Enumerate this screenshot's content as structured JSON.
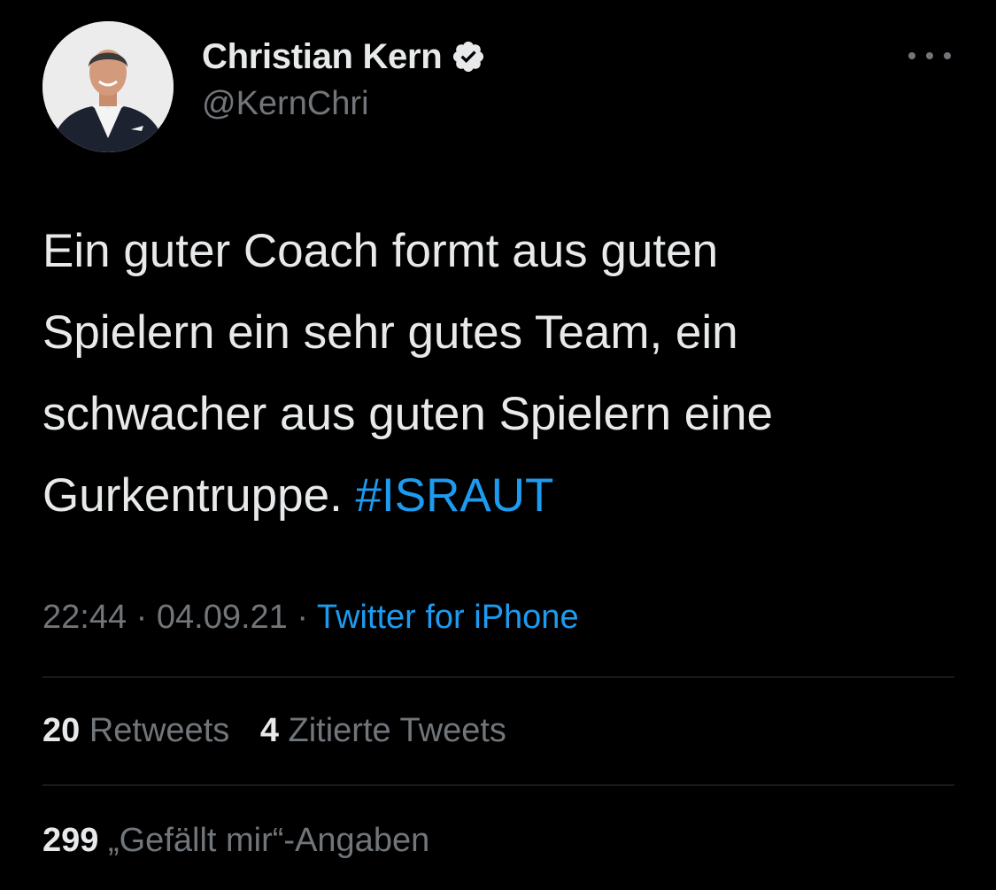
{
  "author": {
    "display_name": "Christian Kern",
    "handle": "@KernChri",
    "verified": true,
    "avatar_icon": "profile-photo"
  },
  "tweet": {
    "lines": [
      "Ein guter Coach formt aus guten",
      "Spielern ein sehr gutes Team, ein",
      "schwacher aus guten Spielern eine",
      "Gurkentruppe."
    ],
    "hashtag": "#ISRAUT"
  },
  "meta": {
    "time": "22:44",
    "separator": "·",
    "date": "04.09.21",
    "source": "Twitter for iPhone"
  },
  "stats": {
    "retweets_count": "20",
    "retweets_label": "Retweets",
    "quotes_count": "4",
    "quotes_label": "Zitierte Tweets",
    "likes_count": "299",
    "likes_label": "„Gefällt mir“-Angaben"
  },
  "colors": {
    "background": "#000000",
    "text_primary": "#e7e9ea",
    "text_secondary": "#71767b",
    "accent": "#1d9bf0",
    "divider": "#2f3336"
  },
  "icons": {
    "verified": "verified-badge-icon",
    "more": "more-options-icon"
  }
}
